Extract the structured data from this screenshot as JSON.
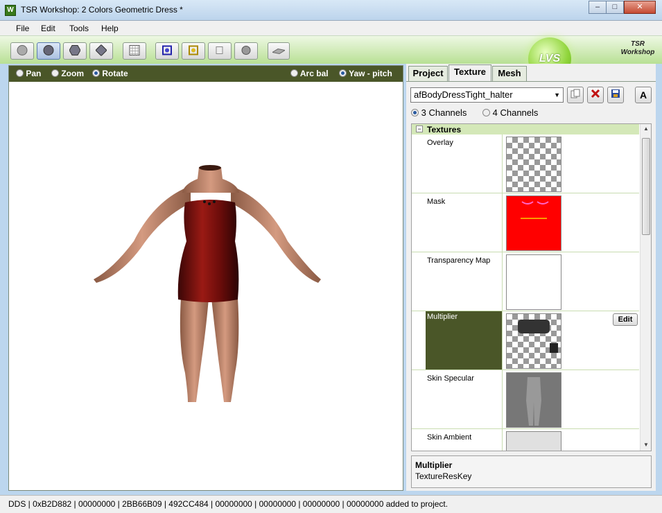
{
  "window": {
    "title": "TSR Workshop: 2 Colors Geometric Dress *",
    "icon_letter": "W",
    "min": "‒",
    "max": "□",
    "close": "✕"
  },
  "menu": [
    "File",
    "Edit",
    "Tools",
    "Help"
  ],
  "toolbar": {
    "buttons": [
      "sphere-shade",
      "sphere-smooth",
      "hex-shape",
      "diamond-shape",
      "grid-view",
      "bone-view",
      "bone-gold",
      "box-shape",
      "ring-shape",
      "floor-plane"
    ],
    "active_index": 1
  },
  "logos": {
    "lvs": "LVS",
    "tsr": "TSR Workshop"
  },
  "viewport": {
    "pan": "Pan",
    "zoom": "Zoom",
    "rotate": "Rotate",
    "arcball": "Arc bal",
    "yawpitch": "Yaw - pitch",
    "selected_mode": "Rotate",
    "selected_nav": "Yaw - pitch"
  },
  "tabs": [
    "Project",
    "Texture",
    "Mesh"
  ],
  "active_tab": "Texture",
  "texture_select": "afBodyDressTight_halter",
  "icon_buttons": [
    "copy-icon",
    "delete-icon",
    "save-icon",
    "font-icon"
  ],
  "font_btn": "A",
  "channels": {
    "three": "3 Channels",
    "four": "4 Channels",
    "selected": "3 Channels"
  },
  "tree": {
    "group": "Textures",
    "rows": [
      {
        "name": "Overlay",
        "thumb": "checker"
      },
      {
        "name": "Mask",
        "thumb": "red"
      },
      {
        "name": "Transparency Map",
        "thumb": "white"
      },
      {
        "name": "Multiplier",
        "thumb": "checker-dark",
        "selected": true,
        "edit": "Edit"
      },
      {
        "name": "Skin Specular",
        "thumb": "gray"
      },
      {
        "name": "Skin Ambient",
        "thumb": "light"
      }
    ]
  },
  "description": {
    "title": "Multiplier",
    "subtitle": "TextureResKey"
  },
  "status": "DDS | 0xB2D882 | 00000000 | 2BB66B09 | 492CC484 | 00000000 | 00000000 | 00000000 | 00000000 added to project."
}
